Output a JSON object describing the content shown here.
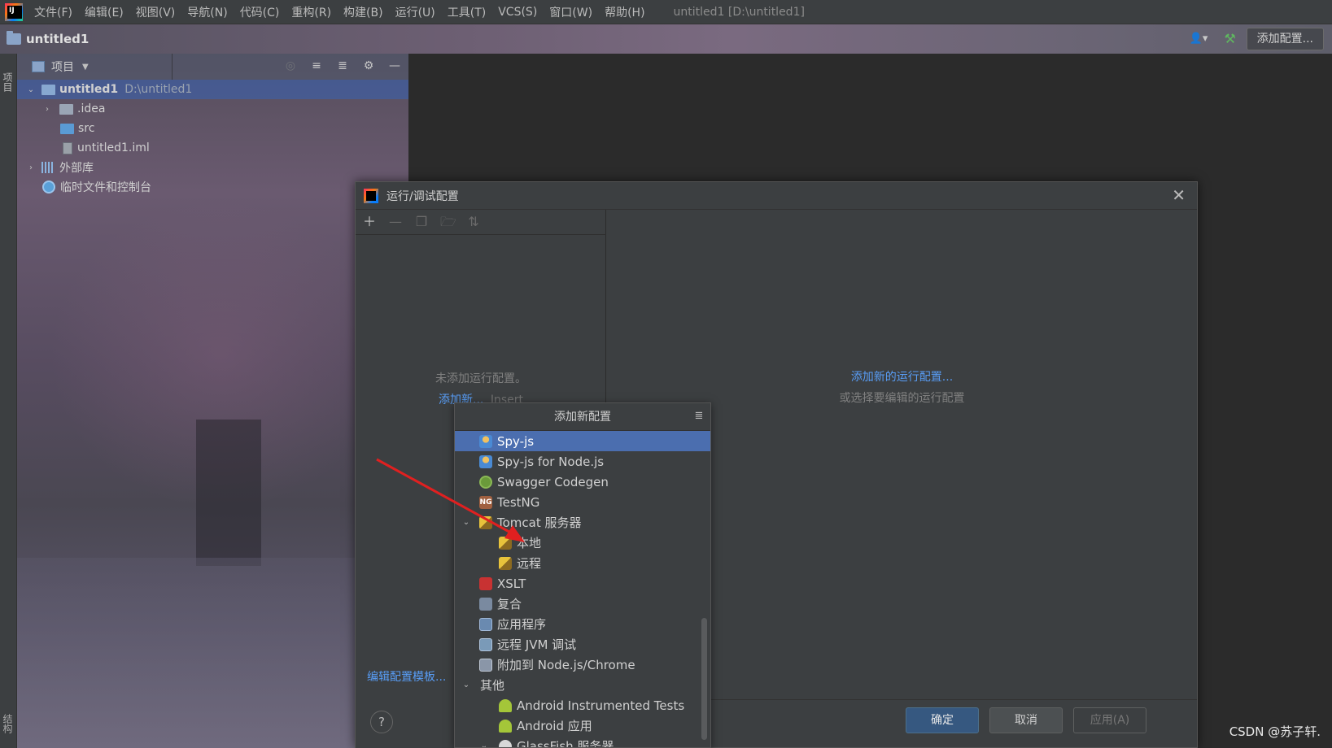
{
  "menubar": {
    "items": [
      "文件(F)",
      "编辑(E)",
      "视图(V)",
      "导航(N)",
      "代码(C)",
      "重构(R)",
      "构建(B)",
      "运行(U)",
      "工具(T)",
      "VCS(S)",
      "窗口(W)",
      "帮助(H)"
    ],
    "window_title": "untitled1 [D:\\untitled1]"
  },
  "navbar": {
    "project": "untitled1",
    "add_config": "添加配置..."
  },
  "left_strip": {
    "project_tab": "项目",
    "structure_tab": "结构"
  },
  "project_panel": {
    "title": "项目",
    "tree": [
      {
        "label": "untitled1",
        "path": "D:\\untitled1"
      },
      {
        "label": ".idea"
      },
      {
        "label": "src"
      },
      {
        "label": "untitled1.iml"
      },
      {
        "label": "外部库"
      },
      {
        "label": "临时文件和控制台"
      }
    ]
  },
  "dialog": {
    "title": "运行/调试配置",
    "empty_text": "未添加运行配置。",
    "add_new_link": "添加新...",
    "add_new_hint": "Insert",
    "edit_templates": "编辑配置模板...",
    "add_new_config_link": "添加新的运行配置...",
    "select_config_text": "或选择要编辑的运行配置",
    "ok": "确定",
    "cancel": "取消",
    "apply": "应用(A)",
    "help": "?"
  },
  "popup": {
    "title": "添加新配置",
    "items": [
      {
        "label": "Spy-js",
        "icon": "spy-js-icon"
      },
      {
        "label": "Spy-js for Node.js",
        "icon": "spy-js-node-icon"
      },
      {
        "label": "Swagger Codegen",
        "icon": "swagger-icon"
      },
      {
        "label": "TestNG",
        "icon": "testng-icon"
      },
      {
        "label": "Tomcat 服务器",
        "icon": "tomcat-icon"
      },
      {
        "label": "本地",
        "icon": "tomcat-local-icon"
      },
      {
        "label": "远程",
        "icon": "tomcat-remote-icon"
      },
      {
        "label": "XSLT",
        "icon": "xslt-icon"
      },
      {
        "label": "复合",
        "icon": "compound-icon"
      },
      {
        "label": "应用程序",
        "icon": "application-icon"
      },
      {
        "label": "远程 JVM 调试",
        "icon": "remote-jvm-icon"
      },
      {
        "label": "附加到 Node.js/Chrome",
        "icon": "attach-node-icon"
      },
      {
        "label": "其他"
      },
      {
        "label": "Android Instrumented Tests",
        "icon": "android-icon"
      },
      {
        "label": "Android 应用",
        "icon": "android-icon"
      },
      {
        "label": "GlassFish 服务器",
        "icon": "glassfish-icon"
      }
    ]
  },
  "watermark": "CSDN @苏子轩.",
  "colors": {
    "selection": "#4b6eaf",
    "link": "#589df6",
    "arrow": "#e02020",
    "primary_button": "#365880"
  }
}
